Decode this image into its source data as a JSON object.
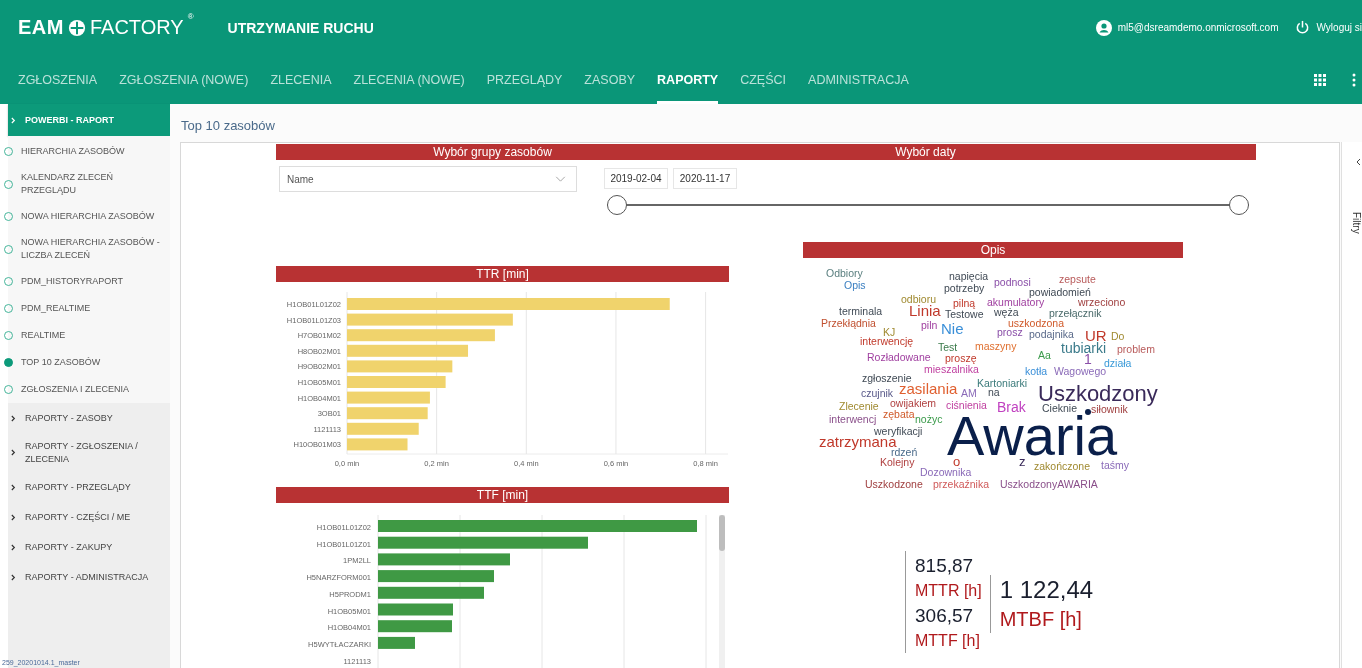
{
  "header": {
    "logo_left": "EAM",
    "logo_right": "FACTORY",
    "logo_mark": "®",
    "app_title": "UTRZYMANIE RUCHU",
    "user_email": "ml5@dsreamdemo.onmicrosoft.com",
    "logout": "Wyloguj si"
  },
  "nav": [
    {
      "label": "ZGŁOSZENIA",
      "selected": false
    },
    {
      "label": "ZGŁOSZENIA (NOWE)",
      "selected": false
    },
    {
      "label": "ZLECENIA",
      "selected": false
    },
    {
      "label": "ZLECENIA (NOWE)",
      "selected": false
    },
    {
      "label": "PRZEGLĄDY",
      "selected": false
    },
    {
      "label": "ZASOBY",
      "selected": false
    },
    {
      "label": "RAPORTY",
      "selected": true
    },
    {
      "label": "CZĘŚCI",
      "selected": false
    },
    {
      "label": "ADMINISTRACJA",
      "selected": false
    }
  ],
  "sidebar": {
    "groups": [
      {
        "label": "POWERBI - RAPORT",
        "expanded": true,
        "children": [
          {
            "label": "HIERARCHIA ZASOBÓW",
            "selected": false
          },
          {
            "label": "KALENDARZ ZLECEŃ PRZEGLĄDU",
            "selected": false
          },
          {
            "label": "NOWA HIERARCHIA ZASOBÓW",
            "selected": false
          },
          {
            "label": "NOWA HIERARCHIA ZASOBÓW - LICZBA ZLECEŃ",
            "selected": false
          },
          {
            "label": "PDM_HISTORYRAPORT",
            "selected": false
          },
          {
            "label": "PDM_REALTIME",
            "selected": false
          },
          {
            "label": "REALTIME",
            "selected": false
          },
          {
            "label": "TOP 10 ZASOBÓW",
            "selected": true
          },
          {
            "label": "ZGŁOSZENIA I ZLECENIA",
            "selected": false
          }
        ]
      },
      {
        "label": "RAPORTY - ZASOBY",
        "expanded": false
      },
      {
        "label": "RAPORTY - ZGŁOSZENIA / ZLECENIA",
        "expanded": false
      },
      {
        "label": "RAPORTY - PRZEGLĄDY",
        "expanded": false
      },
      {
        "label": "RAPORTY - CZĘŚCI / ME",
        "expanded": false
      },
      {
        "label": "RAPORTY - ZAKUPY",
        "expanded": false
      },
      {
        "label": "RAPORTY - ADMINISTRACJA",
        "expanded": false
      }
    ],
    "version": "259_20201014.1_master"
  },
  "breadcrumb": "Top 10 zasobów",
  "report": {
    "group_slicer": {
      "title": "Wybór grupy zasobów",
      "selection": "Name"
    },
    "date_slicer": {
      "title": "Wybór daty",
      "start": "2019-02-04",
      "end": "2020-11-17",
      "handles": [
        {
          "level": 0
        },
        {
          "level": 1
        }
      ]
    },
    "ttr_chart": {
      "title": "TTR [min]",
      "chart_data": {
        "type": "bar",
        "orientation": "horizontal",
        "categories": [
          "H1OB01L01Z02",
          "H1OB01L01Z03",
          "H7OB01M02",
          "H8OB02M01",
          "H9OB02M01",
          "H1OB05M01",
          "H1OB04M01",
          "3OB01",
          "1121113",
          "H10OB01M03"
        ],
        "values": [
          0.72,
          0.37,
          0.33,
          0.27,
          0.235,
          0.22,
          0.185,
          0.18,
          0.16,
          0.135
        ],
        "grid": true,
        "xlim": [
          0,
          0.85
        ],
        "xticks": [
          {
            "value": 0,
            "label": "0,0 min"
          },
          {
            "value": 0.2,
            "label": "0,2 min"
          },
          {
            "value": 0.4,
            "label": "0,4 min"
          },
          {
            "value": 0.6,
            "label": "0,6 min"
          },
          {
            "value": 0.8,
            "label": "0,8 min"
          }
        ]
      }
    },
    "ttf_chart": {
      "title": "TTF [min]",
      "labels": [
        "H1OB01L01Z02",
        "H1OB01L01Z01",
        "1PM2LL",
        "H5NARZFORM001",
        "H5PRODM1",
        "H1OB05M01",
        "H1OB04M01",
        "H5WYTŁACZARKI",
        "1121113"
      ]
    },
    "word_cloud": {
      "title": "Opis",
      "words": [
        "Odbiory",
        "napięcia",
        "podnosi",
        "zepsute",
        "Opis",
        "potrzeby",
        "powiadomień",
        "odbioru",
        "pilną",
        "akumulatory",
        "wrzeciono",
        "terminala",
        "Linia",
        "Testowe",
        "węża",
        "przełącznik",
        "Przekłądnia",
        "piln",
        "Nie",
        "uszkodzona",
        "KJ",
        "prosz",
        "podajnika",
        "UR",
        "Do",
        "interwencję",
        "Test",
        "maszyny",
        "tubiarki",
        "problem",
        "Rozładowane",
        "proszę",
        "Aa",
        "1",
        "działa",
        "mieszalnika",
        "kotła",
        "Wagowego",
        "zgłoszenie",
        "Kartoniarki",
        "czujnik",
        "zasilania",
        "AM",
        "na",
        "Uszkodzony",
        "Zlecenie",
        "owijakiem",
        "ciśnienia",
        "Brak",
        "Cieknie",
        "siłownik",
        "interwencj",
        "zębata",
        "nożyc",
        "zatrzymana",
        "weryfikacji",
        "rdzeń",
        "Awaria",
        "Kolejny",
        "Dozownika",
        "o",
        "z",
        "zakończone",
        "taśmy",
        "Uszkodzone",
        "przekaźnika",
        "UszkodzonyAWARIA"
      ]
    },
    "kpi_cards": [
      {
        "kind": "small",
        "items": [
          {
            "value": "815,87",
            "label": "MTTR [h]"
          },
          {
            "value": "306,57",
            "label": "MTTF [h]"
          }
        ]
      },
      {
        "kind": "large",
        "items": [
          {
            "value": "1 122,44",
            "label": "MTBF [h]"
          }
        ]
      }
    ]
  },
  "filter_pane": {
    "label": "Filtry"
  }
}
